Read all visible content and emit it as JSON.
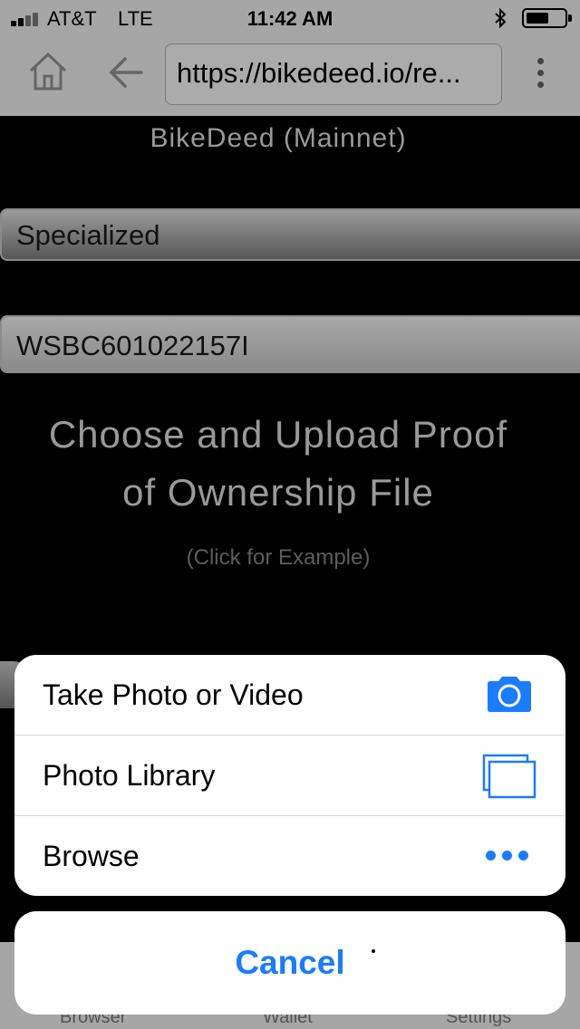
{
  "status_bar": {
    "carrier": "AT&T",
    "network": "LTE",
    "time": "11:42 AM"
  },
  "browser": {
    "url": "https://bikedeed.io/re..."
  },
  "page": {
    "title": "BikeDeed (Mainnet)",
    "manufacturer_value": "Specialized",
    "serial_value": "WSBC601022157I",
    "upload_heading_line1": "Choose and Upload Proof",
    "upload_heading_line2": "of Ownership File",
    "example_link": "(Click for Example)"
  },
  "tab_bar": {
    "items": [
      "Browser",
      "Wallet",
      "Settings"
    ]
  },
  "action_sheet": {
    "options": [
      {
        "label": "Take Photo or Video",
        "icon": "camera-icon"
      },
      {
        "label": "Photo Library",
        "icon": "photo-library-icon"
      },
      {
        "label": "Browse",
        "icon": "more-icon"
      }
    ],
    "cancel_label": "Cancel"
  },
  "colors": {
    "accent": "#1a7cff",
    "chrome": "#a6a6a6",
    "page_background": "#000000",
    "muted_text": "#999999"
  }
}
